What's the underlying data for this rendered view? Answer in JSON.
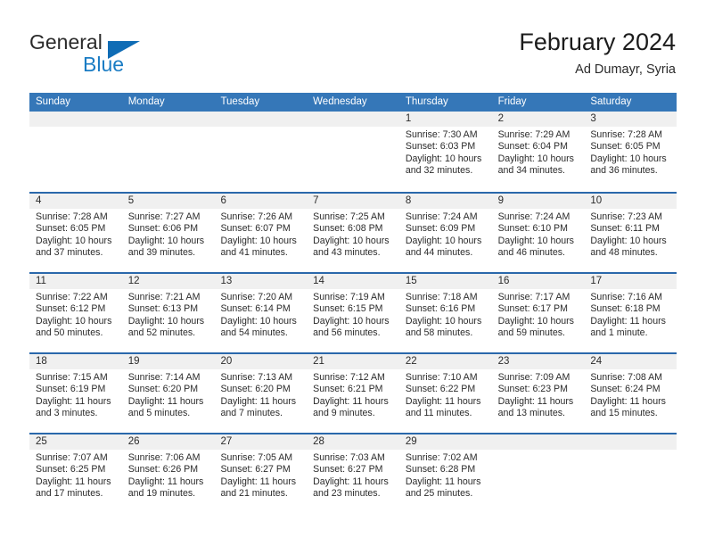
{
  "brand": {
    "word_one": "General",
    "word_two": "Blue",
    "triangle_icon": "triangle-icon",
    "accent_color": "#0f6cb5"
  },
  "header": {
    "title": "February 2024",
    "subtitle": "Ad Dumayr, Syria"
  },
  "calendar": {
    "header_color": "#3577b8",
    "separator_color": "#2a68ab",
    "day_band_color": "#f0f0f0",
    "weekdays": [
      "Sunday",
      "Monday",
      "Tuesday",
      "Wednesday",
      "Thursday",
      "Friday",
      "Saturday"
    ],
    "weeks": [
      [
        {
          "day": "",
          "empty": true,
          "lines": []
        },
        {
          "day": "",
          "empty": true,
          "lines": []
        },
        {
          "day": "",
          "empty": true,
          "lines": []
        },
        {
          "day": "",
          "empty": true,
          "lines": []
        },
        {
          "day": "1",
          "sunrise": "Sunrise: 7:30 AM",
          "sunset": "Sunset: 6:03 PM",
          "daylight_1": "Daylight: 10 hours",
          "daylight_2": "and 32 minutes."
        },
        {
          "day": "2",
          "sunrise": "Sunrise: 7:29 AM",
          "sunset": "Sunset: 6:04 PM",
          "daylight_1": "Daylight: 10 hours",
          "daylight_2": "and 34 minutes."
        },
        {
          "day": "3",
          "sunrise": "Sunrise: 7:28 AM",
          "sunset": "Sunset: 6:05 PM",
          "daylight_1": "Daylight: 10 hours",
          "daylight_2": "and 36 minutes."
        }
      ],
      [
        {
          "day": "4",
          "sunrise": "Sunrise: 7:28 AM",
          "sunset": "Sunset: 6:05 PM",
          "daylight_1": "Daylight: 10 hours",
          "daylight_2": "and 37 minutes."
        },
        {
          "day": "5",
          "sunrise": "Sunrise: 7:27 AM",
          "sunset": "Sunset: 6:06 PM",
          "daylight_1": "Daylight: 10 hours",
          "daylight_2": "and 39 minutes."
        },
        {
          "day": "6",
          "sunrise": "Sunrise: 7:26 AM",
          "sunset": "Sunset: 6:07 PM",
          "daylight_1": "Daylight: 10 hours",
          "daylight_2": "and 41 minutes."
        },
        {
          "day": "7",
          "sunrise": "Sunrise: 7:25 AM",
          "sunset": "Sunset: 6:08 PM",
          "daylight_1": "Daylight: 10 hours",
          "daylight_2": "and 43 minutes."
        },
        {
          "day": "8",
          "sunrise": "Sunrise: 7:24 AM",
          "sunset": "Sunset: 6:09 PM",
          "daylight_1": "Daylight: 10 hours",
          "daylight_2": "and 44 minutes."
        },
        {
          "day": "9",
          "sunrise": "Sunrise: 7:24 AM",
          "sunset": "Sunset: 6:10 PM",
          "daylight_1": "Daylight: 10 hours",
          "daylight_2": "and 46 minutes."
        },
        {
          "day": "10",
          "sunrise": "Sunrise: 7:23 AM",
          "sunset": "Sunset: 6:11 PM",
          "daylight_1": "Daylight: 10 hours",
          "daylight_2": "and 48 minutes."
        }
      ],
      [
        {
          "day": "11",
          "sunrise": "Sunrise: 7:22 AM",
          "sunset": "Sunset: 6:12 PM",
          "daylight_1": "Daylight: 10 hours",
          "daylight_2": "and 50 minutes."
        },
        {
          "day": "12",
          "sunrise": "Sunrise: 7:21 AM",
          "sunset": "Sunset: 6:13 PM",
          "daylight_1": "Daylight: 10 hours",
          "daylight_2": "and 52 minutes."
        },
        {
          "day": "13",
          "sunrise": "Sunrise: 7:20 AM",
          "sunset": "Sunset: 6:14 PM",
          "daylight_1": "Daylight: 10 hours",
          "daylight_2": "and 54 minutes."
        },
        {
          "day": "14",
          "sunrise": "Sunrise: 7:19 AM",
          "sunset": "Sunset: 6:15 PM",
          "daylight_1": "Daylight: 10 hours",
          "daylight_2": "and 56 minutes."
        },
        {
          "day": "15",
          "sunrise": "Sunrise: 7:18 AM",
          "sunset": "Sunset: 6:16 PM",
          "daylight_1": "Daylight: 10 hours",
          "daylight_2": "and 58 minutes."
        },
        {
          "day": "16",
          "sunrise": "Sunrise: 7:17 AM",
          "sunset": "Sunset: 6:17 PM",
          "daylight_1": "Daylight: 10 hours",
          "daylight_2": "and 59 minutes."
        },
        {
          "day": "17",
          "sunrise": "Sunrise: 7:16 AM",
          "sunset": "Sunset: 6:18 PM",
          "daylight_1": "Daylight: 11 hours",
          "daylight_2": "and 1 minute."
        }
      ],
      [
        {
          "day": "18",
          "sunrise": "Sunrise: 7:15 AM",
          "sunset": "Sunset: 6:19 PM",
          "daylight_1": "Daylight: 11 hours",
          "daylight_2": "and 3 minutes."
        },
        {
          "day": "19",
          "sunrise": "Sunrise: 7:14 AM",
          "sunset": "Sunset: 6:20 PM",
          "daylight_1": "Daylight: 11 hours",
          "daylight_2": "and 5 minutes."
        },
        {
          "day": "20",
          "sunrise": "Sunrise: 7:13 AM",
          "sunset": "Sunset: 6:20 PM",
          "daylight_1": "Daylight: 11 hours",
          "daylight_2": "and 7 minutes."
        },
        {
          "day": "21",
          "sunrise": "Sunrise: 7:12 AM",
          "sunset": "Sunset: 6:21 PM",
          "daylight_1": "Daylight: 11 hours",
          "daylight_2": "and 9 minutes."
        },
        {
          "day": "22",
          "sunrise": "Sunrise: 7:10 AM",
          "sunset": "Sunset: 6:22 PM",
          "daylight_1": "Daylight: 11 hours",
          "daylight_2": "and 11 minutes."
        },
        {
          "day": "23",
          "sunrise": "Sunrise: 7:09 AM",
          "sunset": "Sunset: 6:23 PM",
          "daylight_1": "Daylight: 11 hours",
          "daylight_2": "and 13 minutes."
        },
        {
          "day": "24",
          "sunrise": "Sunrise: 7:08 AM",
          "sunset": "Sunset: 6:24 PM",
          "daylight_1": "Daylight: 11 hours",
          "daylight_2": "and 15 minutes."
        }
      ],
      [
        {
          "day": "25",
          "sunrise": "Sunrise: 7:07 AM",
          "sunset": "Sunset: 6:25 PM",
          "daylight_1": "Daylight: 11 hours",
          "daylight_2": "and 17 minutes."
        },
        {
          "day": "26",
          "sunrise": "Sunrise: 7:06 AM",
          "sunset": "Sunset: 6:26 PM",
          "daylight_1": "Daylight: 11 hours",
          "daylight_2": "and 19 minutes."
        },
        {
          "day": "27",
          "sunrise": "Sunrise: 7:05 AM",
          "sunset": "Sunset: 6:27 PM",
          "daylight_1": "Daylight: 11 hours",
          "daylight_2": "and 21 minutes."
        },
        {
          "day": "28",
          "sunrise": "Sunrise: 7:03 AM",
          "sunset": "Sunset: 6:27 PM",
          "daylight_1": "Daylight: 11 hours",
          "daylight_2": "and 23 minutes."
        },
        {
          "day": "29",
          "sunrise": "Sunrise: 7:02 AM",
          "sunset": "Sunset: 6:28 PM",
          "daylight_1": "Daylight: 11 hours",
          "daylight_2": "and 25 minutes."
        },
        {
          "day": "",
          "empty": true
        },
        {
          "day": "",
          "empty": true
        }
      ]
    ]
  }
}
